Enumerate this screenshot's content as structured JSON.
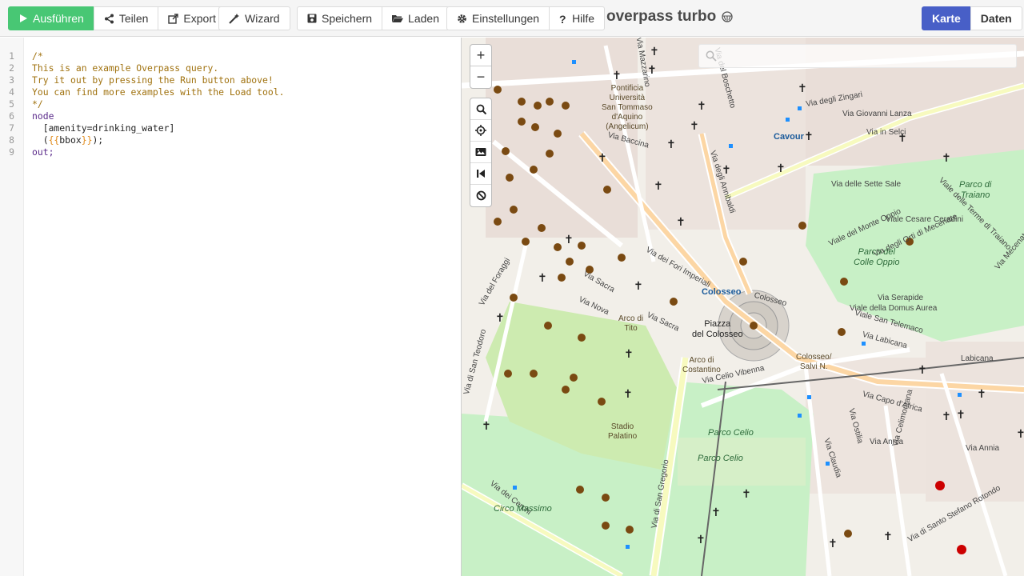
{
  "toolbar": {
    "run_label": "Ausführen",
    "share_label": "Teilen",
    "export_label": "Export",
    "wizard_label": "Wizard",
    "save_label": "Speichern",
    "load_label": "Laden",
    "settings_label": "Einstellungen",
    "help_label": "Hilfe",
    "app_title": "overpass turbo",
    "map_tab_label": "Karte",
    "data_tab_label": "Daten"
  },
  "editor": {
    "line_numbers": [
      "1",
      "2",
      "3",
      "4",
      "5",
      "6",
      "7",
      "8",
      "9"
    ],
    "lines": [
      "/*",
      "This is an example Overpass query.",
      "Try it out by pressing the Run button above!",
      "You can find more examples with the Load tool.",
      "*/",
      "node",
      "  [amenity=drinking_water]",
      "  ({{bbox}});",
      "out;"
    ]
  },
  "map": {
    "zoom_in_label": "+",
    "zoom_out_label": "−",
    "search_placeholder": "",
    "labels": {
      "pontificia": "Pontificia\nUniversità\nSan Tommaso\nd'Aquino\n(Angelicum)",
      "cavour": "Cavour",
      "via_giovanni_lanza": "Via Giovanni Lanza",
      "via_in_selci": "Via in Selci",
      "via_baccina": "Via Baccina",
      "via_degli_zingari": "Via degli Zingari",
      "via_degli_annibaldi": "Via degli Annibaldi",
      "via_delle_sette_sale": "Via delle Sette Sale",
      "parco_di_traiano": "Parco di\nTraiano",
      "parco_colle_oppio": "Parco del\nColle Oppio",
      "viale_del_monte_oppio": "Viale del Monte Oppio",
      "via_fori_imperiali": "Via dei Fori Imperiali",
      "colosseo": "Colosseo",
      "colosseo2": "Colosseo",
      "piazza_del_colosseo": "Piazza\ndel Colosseo",
      "via_labicana": "Via Labicana",
      "labicana": "Labicana",
      "colosseo_salvi": "Colosseo/\nSalvi N.",
      "arco_di_tito": "Arco di\nTito",
      "arco_di_costantino": "Arco di\nCostantino",
      "via_celio_vibenna": "Via Celio Vibenna",
      "via_sacra": "Via Sacra",
      "via_nova": "Via Nova",
      "via_dei_cerchi": "Via dei Cerchi",
      "circo_massimo": "Circo Massimo",
      "via_san_gregorio": "Via di San Gregorio",
      "parco_celio": "Parco Celio",
      "parco_celio2": "Parco Celio",
      "stadio_palatino": "Stadio\nPalatino",
      "via_capo_africa": "Via Capo d'Africa",
      "via_annia": "Via Annia",
      "via_claudia": "Via Claudia",
      "via_san_teodoro": "Via di San Teodoro",
      "via_del_foraggi": "Via del Foraggi",
      "via_serapide": "Via Serapide",
      "viale_domus_aurea": "Viale della Domus Aurea",
      "via_san_telemaco": "Viale San Telemaco",
      "via_ostilia": "Via Ostilia",
      "via_celimontana": "Via Celimontana",
      "via_santo_stefano": "Via di Santo Stefano Rotondo",
      "via_cesare_ceradini": "Viale Cesare Ceradini",
      "via_orti_mecenate": "Via degli Orti di Mecenate",
      "via_terme_traiano": "Viale delle Terme di Traiano",
      "via_mecenate": "Via Mecenate",
      "via_mazzarino": "Via Mazzarino",
      "via_boschetto": "Via del Boschetto"
    }
  },
  "colors": {
    "run_button": "#48c774",
    "active_tab": "#485fc7",
    "comment_text": "#a0720f",
    "keyword_text": "#5a2a8a"
  }
}
